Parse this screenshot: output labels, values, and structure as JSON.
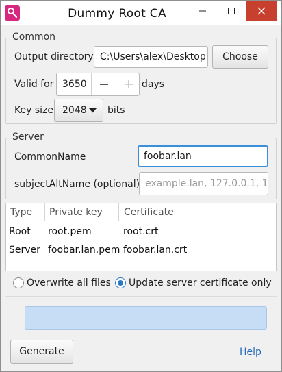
{
  "window": {
    "title": "Dummy Root CA",
    "controls": [
      "minimize-icon",
      "maximize-icon",
      "close-icon"
    ],
    "close_color": "#c7402e",
    "app_icon_color": "#d6287f"
  },
  "common": {
    "legend": "Common",
    "output_dir_label": "Output directory",
    "output_dir_value": "C:\\Users\\alex\\Desktop",
    "choose_label": "Choose",
    "valid_for_label": "Valid for",
    "valid_for_value": "3650",
    "decrement_icon": "minus-icon",
    "increment_icon": "plus-icon",
    "days_label": "days",
    "key_size_label": "Key size",
    "key_size_value": "2048",
    "bits_label": "bits"
  },
  "server": {
    "legend": "Server",
    "common_name_label": "CommonName",
    "common_name_value": "foobar.lan",
    "san_label": "subjectAltName (optional)",
    "san_placeholder": "example.lan, 127.0.0.1, 1..."
  },
  "files": {
    "columns": [
      "Type",
      "Private key",
      "Certificate"
    ],
    "rows": [
      [
        "Root",
        "root.pem",
        "root.crt"
      ],
      [
        "Server",
        "foobar.lan.pem",
        "foobar.lan.crt"
      ]
    ]
  },
  "options": {
    "overwrite_label": "Overwrite all files",
    "overwrite_selected": false,
    "update_label": "Update server certificate only",
    "update_selected": true
  },
  "progress": {
    "value": 0,
    "color": "#c7ddf5"
  },
  "footer": {
    "generate_label": "Generate",
    "help_label": "Help",
    "link_color": "#2a6ab8"
  }
}
